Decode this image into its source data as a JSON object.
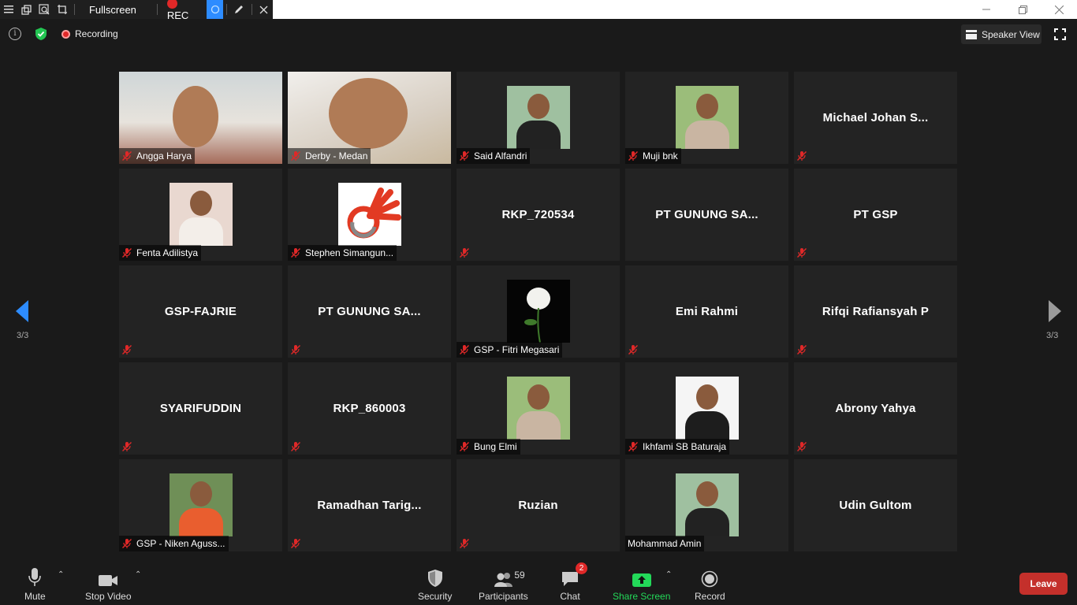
{
  "titlebar": {
    "fullscreen_label": "Fullscreen",
    "rec_label": "REC"
  },
  "infobar": {
    "recording_label": "Recording",
    "speaker_view_label": "Speaker View"
  },
  "nav": {
    "page_indicator_left": "3/3",
    "page_indicator_right": "3/3"
  },
  "tiles": [
    {
      "name": "Angga Harya",
      "muted": true,
      "video": "live"
    },
    {
      "name": "Derby - Medan",
      "muted": true,
      "video": "live"
    },
    {
      "name": "Said Alfandri",
      "muted": true,
      "video": "photo"
    },
    {
      "name": "Muji bnk",
      "muted": true,
      "video": "photo"
    },
    {
      "name": "Michael Johan S...",
      "muted": true,
      "video": "none"
    },
    {
      "name": "Fenta Adilistya",
      "muted": true,
      "video": "photo"
    },
    {
      "name": "Stephen Simangun...",
      "muted": true,
      "video": "logo"
    },
    {
      "name": "RKP_720534",
      "muted": true,
      "video": "none"
    },
    {
      "name": "PT GUNUNG SA...",
      "muted": false,
      "video": "none"
    },
    {
      "name": "PT GSP",
      "muted": true,
      "video": "none"
    },
    {
      "name": "GSP-FAJRIE",
      "muted": true,
      "video": "none"
    },
    {
      "name": "PT GUNUNG SA...",
      "muted": true,
      "video": "none"
    },
    {
      "name": "GSP - Fitri Megasari",
      "muted": true,
      "video": "rose"
    },
    {
      "name": "Emi Rahmi",
      "muted": true,
      "video": "none"
    },
    {
      "name": "Rifqi Rafiansyah P",
      "muted": true,
      "video": "none"
    },
    {
      "name": "SYARIFUDDIN",
      "muted": true,
      "video": "none"
    },
    {
      "name": "RKP_860003",
      "muted": true,
      "video": "none"
    },
    {
      "name": "Bung Elmi",
      "muted": true,
      "video": "photo"
    },
    {
      "name": "Ikhfami SB Baturaja",
      "muted": true,
      "video": "photo"
    },
    {
      "name": "Abrony Yahya",
      "muted": true,
      "video": "none"
    },
    {
      "name": "GSP - Niken Aguss...",
      "muted": true,
      "video": "photo"
    },
    {
      "name": "Ramadhan  Tarig...",
      "muted": true,
      "video": "none"
    },
    {
      "name": "Ruzian",
      "muted": true,
      "video": "none"
    },
    {
      "name": "Mohammad Amin",
      "muted": false,
      "video": "photo"
    },
    {
      "name": "Udin Gultom",
      "muted": false,
      "video": "none"
    }
  ],
  "toolbar": {
    "mute_label": "Mute",
    "stop_video_label": "Stop Video",
    "security_label": "Security",
    "participants_label": "Participants",
    "participants_count": "59",
    "chat_label": "Chat",
    "chat_badge": "2",
    "share_screen_label": "Share Screen",
    "record_label": "Record",
    "leave_label": "Leave"
  },
  "colors": {
    "accent_blue": "#2d8cff",
    "share_green": "#23d959",
    "leave_red": "#c4302b",
    "rec_red": "#e02828"
  }
}
